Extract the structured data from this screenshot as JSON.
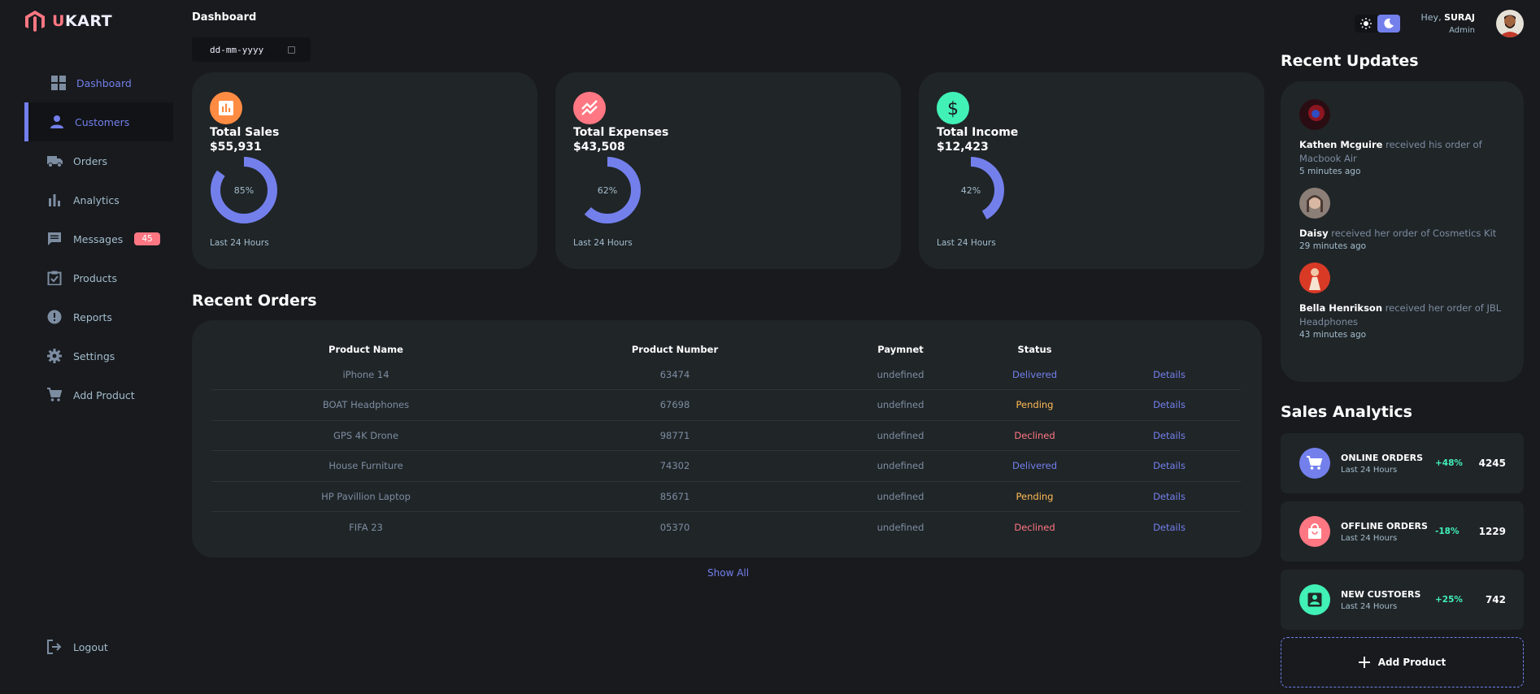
{
  "brand": {
    "prefix": "U",
    "rest": "KART"
  },
  "sidebar": {
    "items": [
      {
        "label": "Dashboard",
        "icon": "grid-icon"
      },
      {
        "label": "Customers",
        "icon": "person-icon"
      },
      {
        "label": "Orders",
        "icon": "truck-icon"
      },
      {
        "label": "Analytics",
        "icon": "bar-chart-icon"
      },
      {
        "label": "Messages",
        "icon": "chat-icon",
        "badge": "45"
      },
      {
        "label": "Products",
        "icon": "clipboard-check-icon"
      },
      {
        "label": "Reports",
        "icon": "alert-icon"
      },
      {
        "label": "Settings",
        "icon": "gear-icon"
      },
      {
        "label": "Add Product",
        "icon": "cart-icon"
      }
    ],
    "logout": "Logout"
  },
  "header": {
    "title": "Dashboard",
    "date_placeholder": "dd-mm-yyyy"
  },
  "cards": [
    {
      "title": "Total Sales",
      "value": "$55,931",
      "percent": "85%",
      "fraction": 0.85,
      "footer": "Last 24 Hours",
      "color": "#ff8c42"
    },
    {
      "title": "Total Expenses",
      "value": "$43,508",
      "percent": "62%",
      "fraction": 0.62,
      "footer": "Last 24 Hours",
      "color": "#ff7782"
    },
    {
      "title": "Total Income",
      "value": "$12,423",
      "percent": "42%",
      "fraction": 0.42,
      "footer": "Last 24 Hours",
      "color": "#41f1b6"
    }
  ],
  "recent_orders": {
    "title": "Recent Orders",
    "columns": [
      "Product Name",
      "Product Number",
      "Paymnet",
      "Status",
      ""
    ],
    "rows": [
      {
        "name": "iPhone 14",
        "number": "63474",
        "payment": "undefined",
        "status": "Delivered",
        "action": "Details"
      },
      {
        "name": "BOAT Headphones",
        "number": "67698",
        "payment": "undefined",
        "status": "Pending",
        "action": "Details"
      },
      {
        "name": "GPS 4K Drone",
        "number": "98771",
        "payment": "undefined",
        "status": "Declined",
        "action": "Details"
      },
      {
        "name": "House Furniture",
        "number": "74302",
        "payment": "undefined",
        "status": "Delivered",
        "action": "Details"
      },
      {
        "name": "HP Pavillion Laptop",
        "number": "85671",
        "payment": "undefined",
        "status": "Pending",
        "action": "Details"
      },
      {
        "name": "FIFA 23",
        "number": "05370",
        "payment": "undefined",
        "status": "Declined",
        "action": "Details"
      }
    ],
    "show_all": "Show All"
  },
  "profile": {
    "greeting": "Hey,",
    "name": "SURAJ",
    "role": "Admin"
  },
  "recent_updates": {
    "title": "Recent Updates",
    "items": [
      {
        "name": "Kathen Mcguire",
        "text": " received his order of Macbook Air",
        "time": "5 minutes ago"
      },
      {
        "name": "Daisy",
        "text": " received her order of Cosmetics Kit",
        "time": "29 minutes ago"
      },
      {
        "name": "Bella Henrikson",
        "text": " received her order of JBL Headphones",
        "time": "43 minutes ago"
      }
    ]
  },
  "sales_analytics": {
    "title": "Sales Analytics",
    "items": [
      {
        "title": "ONLINE ORDERS",
        "subtitle": "Last 24 Hours",
        "change": "+48%",
        "count": "4245",
        "color": "#7380ec",
        "icon": "cart-icon"
      },
      {
        "title": "OFFLINE ORDERS",
        "subtitle": "Last 24 Hours",
        "change": "-18%",
        "count": "1229",
        "color": "#ff7782",
        "icon": "bag-icon"
      },
      {
        "title": "NEW CUSTOERS",
        "subtitle": "Last 24 Hours",
        "change": "+25%",
        "count": "742",
        "color": "#41f1b6",
        "icon": "person-icon"
      }
    ],
    "add_product": "Add Product"
  }
}
